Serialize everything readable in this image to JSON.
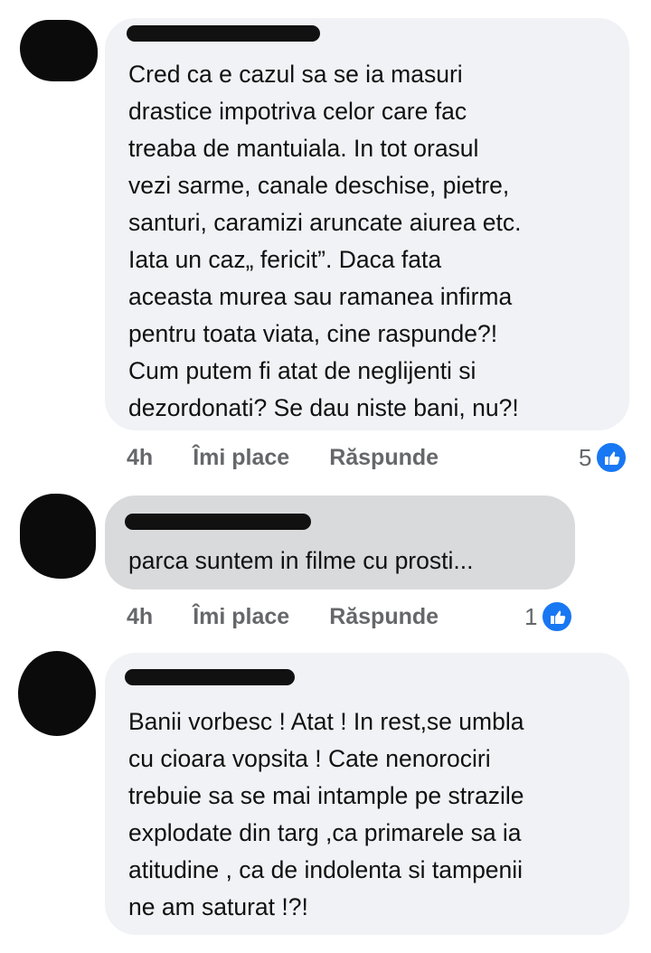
{
  "comments": [
    {
      "text_lines": [
        "Cred ca e cazul sa se ia masuri",
        "drastice impotriva celor care fac",
        "treaba de mantuiala.  In tot orasul",
        "vezi sarme, canale deschise, pietre,",
        "santuri, caramizi aruncate aiurea etc.",
        "Iata un caz„ fericit”. Daca fata",
        "aceasta murea sau ramanea infirma",
        "pentru toata viata, cine raspunde?!",
        "Cum putem fi atat de neglijenti si",
        "dezordonati? Se dau niste bani, nu?!"
      ],
      "time": "4h",
      "like_label": "Îmi place",
      "reply_label": "Răspunde",
      "reaction_count": "5"
    },
    {
      "text_lines": [
        "parca suntem in filme cu prosti..."
      ],
      "time": "4h",
      "like_label": "Îmi place",
      "reply_label": "Răspunde",
      "reaction_count": "1"
    },
    {
      "text_lines": [
        "Banii vorbesc ! Atat ! In rest,se umbla",
        "cu cioara vopsita ! Cate nenorociri",
        "trebuie sa se mai intample pe strazile",
        "explodate din targ ,ca primarele sa ia",
        "atitudine , ca de indolenta si tampenii",
        "ne am saturat !?!"
      ]
    }
  ],
  "colors": {
    "bubble": "#f0f2f5",
    "bubble_selected": "#d9dadc",
    "meta_text": "#65676b",
    "like_blue": "#1877f2"
  },
  "icons": [
    "like-reaction-icon"
  ]
}
